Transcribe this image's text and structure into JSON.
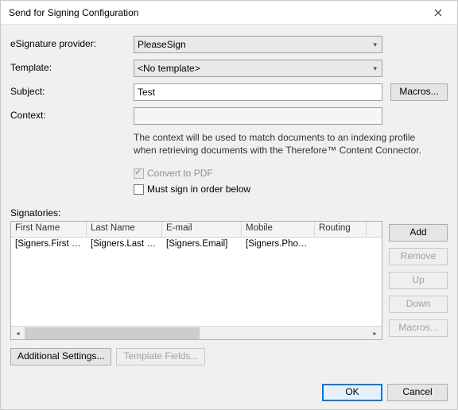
{
  "title": "Send for Signing Configuration",
  "labels": {
    "provider": "eSignature provider:",
    "template": "Template:",
    "subject": "Subject:",
    "context": "Context:",
    "signatories": "Signatories:"
  },
  "provider": {
    "value": "PleaseSign"
  },
  "template": {
    "value": "<No template>"
  },
  "subject": {
    "value": "Test"
  },
  "context": {
    "value": ""
  },
  "helpText": "The context will be used to match documents to an indexing profile when retrieving documents with the Therefore™ Content Connector.",
  "checks": {
    "convertPdf": "Convert to PDF",
    "mustSign": "Must sign in order below"
  },
  "table": {
    "cols": {
      "fn": "First Name",
      "ln": "Last Name",
      "em": "E-mail",
      "mo": "Mobile",
      "rt": "Routing"
    },
    "row": {
      "fn": "[Signers.First Na...",
      "ln": "[Signers.Last Na...",
      "em": "[Signers.Email]",
      "mo": "[Signers.Phone]",
      "rt": ""
    }
  },
  "buttons": {
    "macros": "Macros...",
    "add": "Add",
    "remove": "Remove",
    "up": "Up",
    "down": "Down",
    "macros2": "Macros...",
    "addlSettings": "Additional Settings...",
    "templateFields": "Template Fields...",
    "ok": "OK",
    "cancel": "Cancel"
  }
}
